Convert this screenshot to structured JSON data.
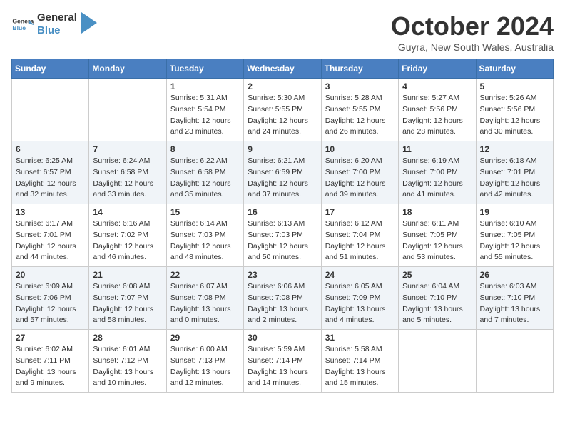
{
  "logo": {
    "text_general": "General",
    "text_blue": "Blue"
  },
  "header": {
    "month": "October 2024",
    "location": "Guyra, New South Wales, Australia"
  },
  "weekdays": [
    "Sunday",
    "Monday",
    "Tuesday",
    "Wednesday",
    "Thursday",
    "Friday",
    "Saturday"
  ],
  "rows": [
    [
      {
        "day": "",
        "info": ""
      },
      {
        "day": "",
        "info": ""
      },
      {
        "day": "1",
        "sunrise": "5:31 AM",
        "sunset": "5:54 PM",
        "daylight": "12 hours and 23 minutes."
      },
      {
        "day": "2",
        "sunrise": "5:30 AM",
        "sunset": "5:55 PM",
        "daylight": "12 hours and 24 minutes."
      },
      {
        "day": "3",
        "sunrise": "5:28 AM",
        "sunset": "5:55 PM",
        "daylight": "12 hours and 26 minutes."
      },
      {
        "day": "4",
        "sunrise": "5:27 AM",
        "sunset": "5:56 PM",
        "daylight": "12 hours and 28 minutes."
      },
      {
        "day": "5",
        "sunrise": "5:26 AM",
        "sunset": "5:56 PM",
        "daylight": "12 hours and 30 minutes."
      }
    ],
    [
      {
        "day": "6",
        "sunrise": "6:25 AM",
        "sunset": "6:57 PM",
        "daylight": "12 hours and 32 minutes."
      },
      {
        "day": "7",
        "sunrise": "6:24 AM",
        "sunset": "6:58 PM",
        "daylight": "12 hours and 33 minutes."
      },
      {
        "day": "8",
        "sunrise": "6:22 AM",
        "sunset": "6:58 PM",
        "daylight": "12 hours and 35 minutes."
      },
      {
        "day": "9",
        "sunrise": "6:21 AM",
        "sunset": "6:59 PM",
        "daylight": "12 hours and 37 minutes."
      },
      {
        "day": "10",
        "sunrise": "6:20 AM",
        "sunset": "7:00 PM",
        "daylight": "12 hours and 39 minutes."
      },
      {
        "day": "11",
        "sunrise": "6:19 AM",
        "sunset": "7:00 PM",
        "daylight": "12 hours and 41 minutes."
      },
      {
        "day": "12",
        "sunrise": "6:18 AM",
        "sunset": "7:01 PM",
        "daylight": "12 hours and 42 minutes."
      }
    ],
    [
      {
        "day": "13",
        "sunrise": "6:17 AM",
        "sunset": "7:01 PM",
        "daylight": "12 hours and 44 minutes."
      },
      {
        "day": "14",
        "sunrise": "6:16 AM",
        "sunset": "7:02 PM",
        "daylight": "12 hours and 46 minutes."
      },
      {
        "day": "15",
        "sunrise": "6:14 AM",
        "sunset": "7:03 PM",
        "daylight": "12 hours and 48 minutes."
      },
      {
        "day": "16",
        "sunrise": "6:13 AM",
        "sunset": "7:03 PM",
        "daylight": "12 hours and 50 minutes."
      },
      {
        "day": "17",
        "sunrise": "6:12 AM",
        "sunset": "7:04 PM",
        "daylight": "12 hours and 51 minutes."
      },
      {
        "day": "18",
        "sunrise": "6:11 AM",
        "sunset": "7:05 PM",
        "daylight": "12 hours and 53 minutes."
      },
      {
        "day": "19",
        "sunrise": "6:10 AM",
        "sunset": "7:05 PM",
        "daylight": "12 hours and 55 minutes."
      }
    ],
    [
      {
        "day": "20",
        "sunrise": "6:09 AM",
        "sunset": "7:06 PM",
        "daylight": "12 hours and 57 minutes."
      },
      {
        "day": "21",
        "sunrise": "6:08 AM",
        "sunset": "7:07 PM",
        "daylight": "12 hours and 58 minutes."
      },
      {
        "day": "22",
        "sunrise": "6:07 AM",
        "sunset": "7:08 PM",
        "daylight": "13 hours and 0 minutes."
      },
      {
        "day": "23",
        "sunrise": "6:06 AM",
        "sunset": "7:08 PM",
        "daylight": "13 hours and 2 minutes."
      },
      {
        "day": "24",
        "sunrise": "6:05 AM",
        "sunset": "7:09 PM",
        "daylight": "13 hours and 4 minutes."
      },
      {
        "day": "25",
        "sunrise": "6:04 AM",
        "sunset": "7:10 PM",
        "daylight": "13 hours and 5 minutes."
      },
      {
        "day": "26",
        "sunrise": "6:03 AM",
        "sunset": "7:10 PM",
        "daylight": "13 hours and 7 minutes."
      }
    ],
    [
      {
        "day": "27",
        "sunrise": "6:02 AM",
        "sunset": "7:11 PM",
        "daylight": "13 hours and 9 minutes."
      },
      {
        "day": "28",
        "sunrise": "6:01 AM",
        "sunset": "7:12 PM",
        "daylight": "13 hours and 10 minutes."
      },
      {
        "day": "29",
        "sunrise": "6:00 AM",
        "sunset": "7:13 PM",
        "daylight": "13 hours and 12 minutes."
      },
      {
        "day": "30",
        "sunrise": "5:59 AM",
        "sunset": "7:14 PM",
        "daylight": "13 hours and 14 minutes."
      },
      {
        "day": "31",
        "sunrise": "5:58 AM",
        "sunset": "7:14 PM",
        "daylight": "13 hours and 15 minutes."
      },
      {
        "day": "",
        "info": ""
      },
      {
        "day": "",
        "info": ""
      }
    ]
  ],
  "labels": {
    "sunrise": "Sunrise: ",
    "sunset": "Sunset: ",
    "daylight": "Daylight: "
  }
}
